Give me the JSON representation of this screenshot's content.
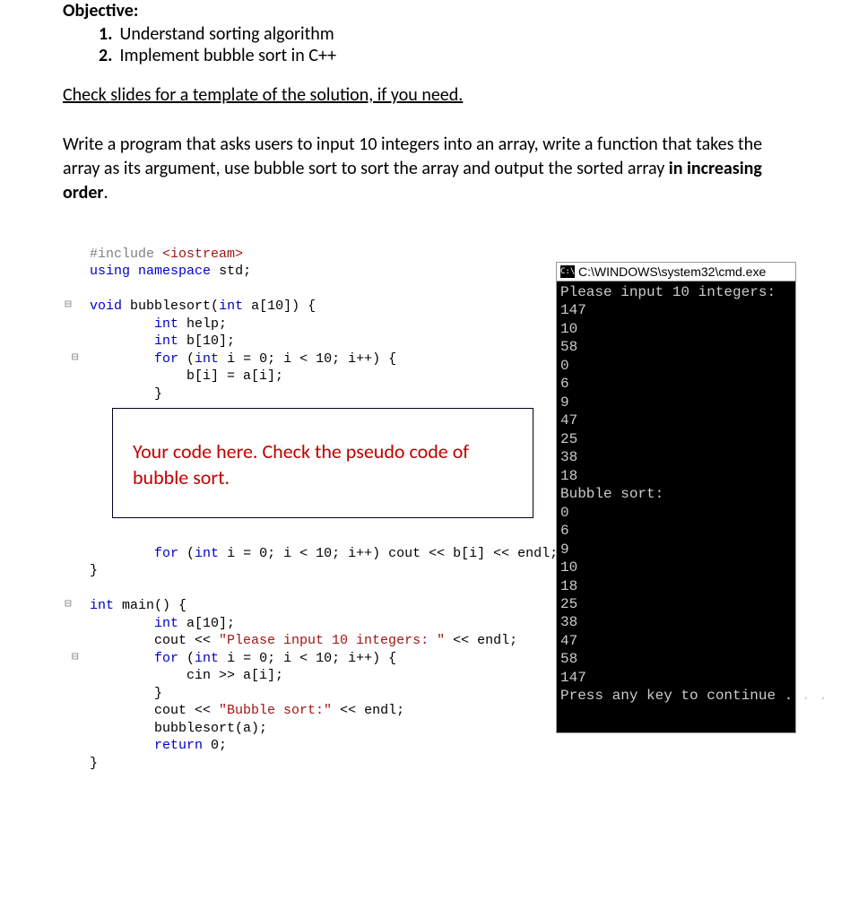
{
  "heading": "Objective:",
  "objectives": [
    "Understand sorting algorithm",
    "Implement bubble sort in C++"
  ],
  "note": "Check slides for a template of the solution, if you need.",
  "instruction_plain": "Write a program that asks users to input 10 integers into an array, write a function that takes the array as its argument, use bubble sort to sort the array and output the sorted array ",
  "instruction_bold": "in increasing order",
  "instruction_end": ".",
  "code": {
    "include_kw": "#include",
    "include_hdr": "<iostream>",
    "using": "using",
    "namespace": "namespace",
    "std": "std;",
    "void": "void",
    "bubblesort_sig": "bubblesort(",
    "int": "int",
    "a10": " a[10]) {",
    "help": " help;",
    "b10": " b[10];",
    "for": "for",
    "for1": " (",
    "i_eq0": " i = 0; i < 10; i++) {",
    "body_copy": "            b[i] = a[i];",
    "rbrace": "        }",
    "for_out": " (",
    "i_eq0b": " i = 0; i < 10; i++) cout << b[i] << endl;",
    "main_sig": " main() {",
    "a10b": " a[10];",
    "cout1a": "        cout << ",
    "str1": "\"Please input 10 integers: \"",
    "cout1b": " << endl;",
    "for2": " (",
    "i_eq0c": " i = 0; i < 10; i++) {",
    "cin": "            cin >> a[i];",
    "rbrace2": "        }",
    "cout2a": "        cout << ",
    "str2": "\"Bubble sort:\"",
    "cout2b": " << endl;",
    "call": "        bubblesort(a);",
    "return": "return",
    "ret0": " 0;",
    "rbrace3": "}"
  },
  "placeholder": "Your code here. Check the pseudo code of bubble sort.",
  "terminal": {
    "title": "C:\\WINDOWS\\system32\\cmd.exe",
    "lines": [
      "Please input 10 integers:",
      "147",
      "10",
      "58",
      "0",
      "6",
      "9",
      "47",
      "25",
      "38",
      "18",
      "Bubble sort:",
      "0",
      "6",
      "9",
      "10",
      "18",
      "25",
      "38",
      "47",
      "58",
      "147",
      "Press any key to continue . . ."
    ]
  }
}
